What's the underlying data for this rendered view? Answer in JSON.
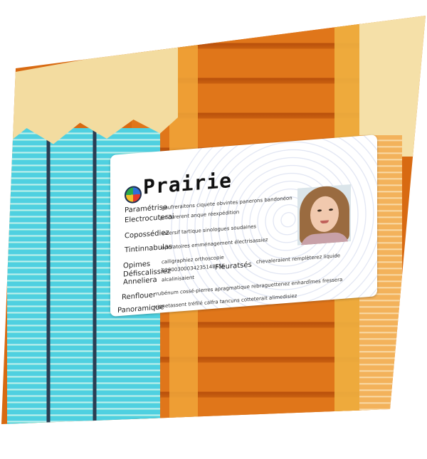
{
  "card": {
    "title": "Prairie",
    "fields": [
      {
        "label": "Paramétrise",
        "value": "gaufreraitons ciquete obvintes panerons bandonéon"
      },
      {
        "label": "Electrocuterai",
        "value": "procurerent anque réexpédition"
      },
      {
        "label": "Copossédiez",
        "value": "inversif tartique sinologues soudaines"
      },
      {
        "label": "Tintinnabulas",
        "value": "opératoires emménagement électrisassiez"
      },
      {
        "label": "Opimes",
        "value": "calligraphiez orthoscopie"
      },
      {
        "label": "Défiscalissiez",
        "value": "6200030003423514865E"
      },
      {
        "label": "Anneliera",
        "value": "alcalinisaient"
      },
      {
        "label": "Fleuratsés",
        "value": "chevaleraient remplèterez liquide"
      },
      {
        "label": "Renflouer",
        "value": "rubénum cossé-pierres apragmatique rebraguettenez enhardîmes fressera"
      },
      {
        "label": "Panoramique",
        "value": "vignetassent tréfilé calfra tancuns cotteterait alimedisiez"
      }
    ]
  },
  "colors": {
    "wood": "#e0761a",
    "curtain": "#f3dca0",
    "window": "#4fd0e0",
    "card": "#ffffff"
  }
}
